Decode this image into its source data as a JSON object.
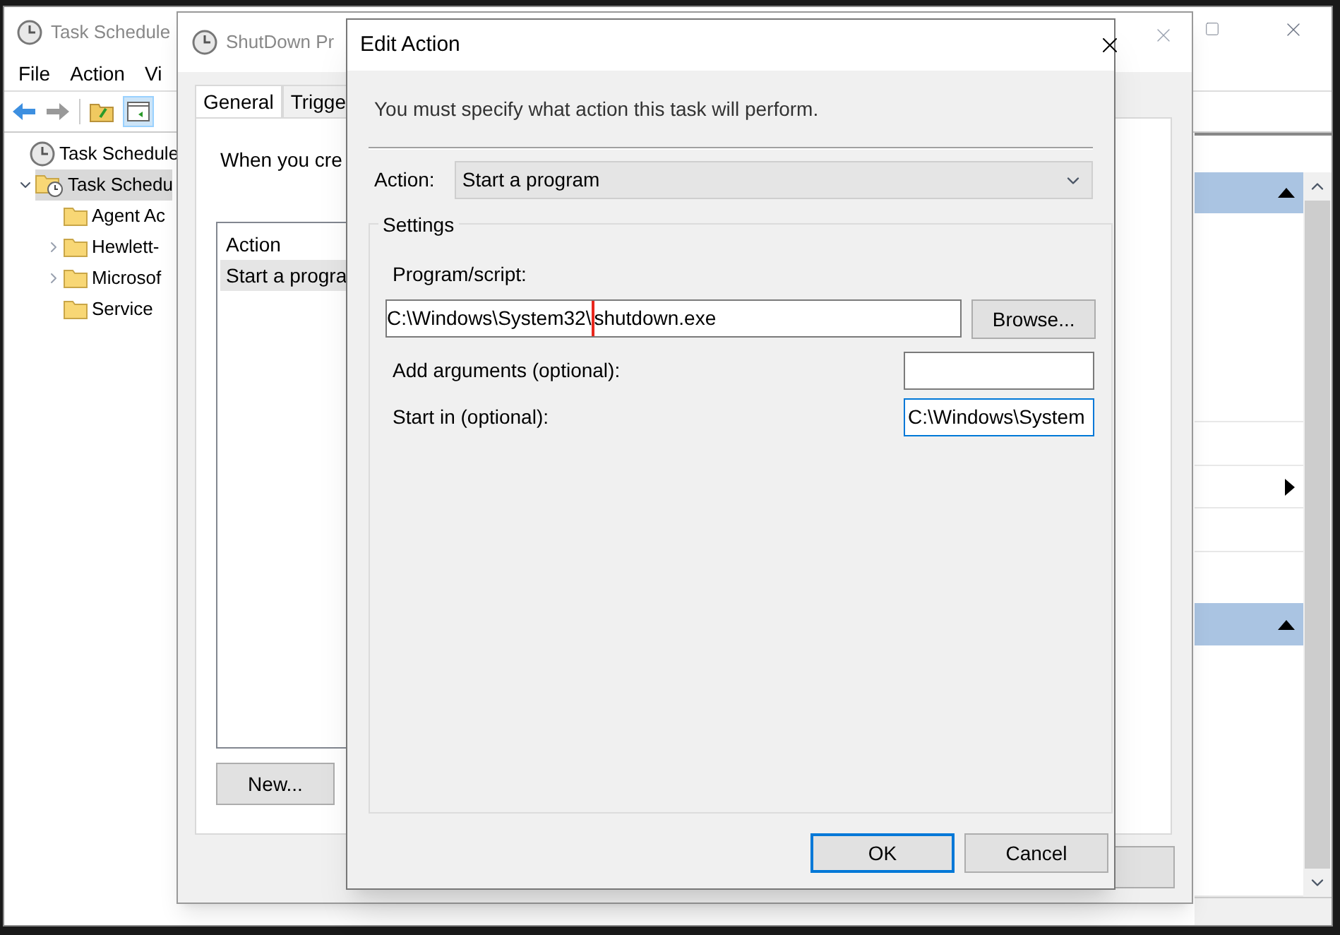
{
  "main_window": {
    "title": "Task Schedule",
    "menu": [
      "File",
      "Action",
      "Vi"
    ],
    "tree": [
      {
        "label": "Task Schedule",
        "kind": "root",
        "children": [
          {
            "label": "Task Schedu",
            "kind": "library",
            "selected": true,
            "expandable": true,
            "expanded": true,
            "children": [
              {
                "label": "Agent Ac",
                "kind": "folder",
                "selected": false,
                "expandable": false
              },
              {
                "label": "Hewlett-",
                "kind": "folder",
                "selected": false,
                "expandable": true,
                "expanded": false
              },
              {
                "label": "Microsof",
                "kind": "folder",
                "selected": false,
                "expandable": true,
                "expanded": false
              },
              {
                "label": "Service",
                "kind": "folder",
                "selected": false,
                "expandable": false
              }
            ]
          }
        ]
      }
    ]
  },
  "properties_window": {
    "title": "ShutDown Pr",
    "tabs": [
      {
        "label": "General",
        "selected": true
      },
      {
        "label": "Trigge",
        "selected": false
      }
    ],
    "intro": "When you cre",
    "actions_list": {
      "columns": [
        "Action"
      ],
      "rows": [
        {
          "cells": [
            "Start a progra"
          ],
          "selected": true
        }
      ]
    },
    "new_button": "New..."
  },
  "edit_action": {
    "title": "Edit Action",
    "instruction": "You must specify what action this task will perform.",
    "action": {
      "label": "Action:",
      "value": "Start a program"
    },
    "settings": {
      "title": "Settings",
      "program": {
        "label": "Program/script:",
        "value_parts": [
          {
            "text": "C:\\Windows\\System32\\",
            "highlighted": true
          },
          {
            "text": "shutdown.exe",
            "highlighted": false
          }
        ],
        "browse": "Browse..."
      },
      "arguments": {
        "label": "Add arguments (optional):",
        "focused": false
      },
      "start_in": {
        "label": "Start in (optional):",
        "value": "C:\\Windows\\System",
        "focused": true
      }
    },
    "buttons": [
      {
        "label": "OK",
        "default": true
      },
      {
        "label": "Cancel",
        "default": false
      }
    ]
  }
}
